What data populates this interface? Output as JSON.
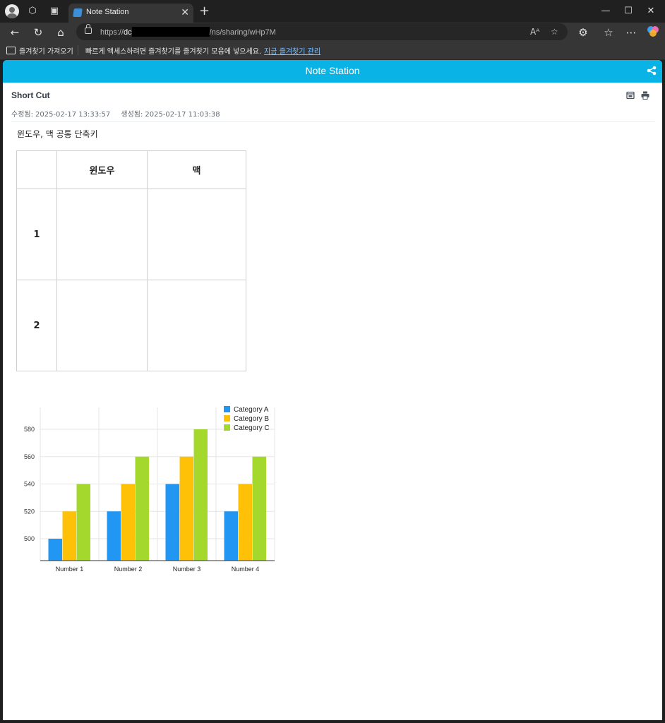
{
  "browser": {
    "tab_title": "Note Station",
    "url_prefix": "https://",
    "url_host_visible": "dc",
    "url_path": "/ns/sharing/wHp7M",
    "favorites_import": "즐겨찾기 가져오기",
    "favorites_message": "빠르게 액세스하려면 즐겨찾기를 즐겨찾기 모음에 넣으세요.",
    "favorites_link": "지금 즐겨찾기 관리"
  },
  "app": {
    "title": "Note Station"
  },
  "note": {
    "title": "Short Cut",
    "modified_label": "수정됨:",
    "modified": "2025-02-17 13:33:57",
    "created_label": "생성됨:",
    "created": "2025-02-17 11:03:38",
    "subtitle": "윈도우, 맥 공통 단축키"
  },
  "table": {
    "headers": [
      "",
      "윈도우",
      "맥"
    ],
    "rows": [
      [
        "1",
        "",
        ""
      ],
      [
        "2",
        "",
        ""
      ]
    ]
  },
  "chart_data": {
    "type": "bar",
    "categories": [
      "Number 1",
      "Number 2",
      "Number 3",
      "Number 4"
    ],
    "series": [
      {
        "name": "Category A",
        "color": "#2196f3",
        "values": [
          500,
          520,
          540,
          520
        ]
      },
      {
        "name": "Category B",
        "color": "#ffc107",
        "values": [
          520,
          540,
          560,
          540
        ]
      },
      {
        "name": "Category C",
        "color": "#a5d82c",
        "values": [
          540,
          560,
          580,
          560
        ]
      }
    ],
    "ylim": [
      484,
      596
    ],
    "yticks": [
      500,
      520,
      540,
      560,
      580
    ],
    "grid": true,
    "legend": "top-right",
    "title": "",
    "xlabel": "",
    "ylabel": ""
  }
}
